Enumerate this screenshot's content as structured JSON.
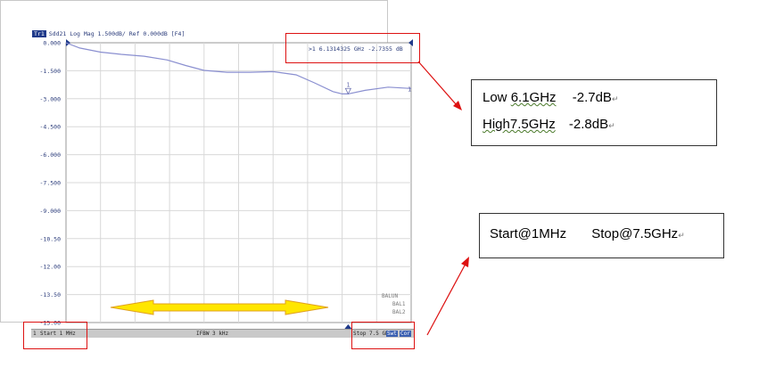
{
  "trace_header": {
    "badge": "Tr1",
    "text": "Sdd21 Log Mag 1.500dB/ Ref 0.000dB [F4]"
  },
  "marker_readout": ">1  6.1314325 GHz -2.7355 dB",
  "chart_data": {
    "type": "line",
    "title": "",
    "xlabel": "",
    "ylabel": "",
    "x_unit": "GHz",
    "xlim": [
      0.001,
      7.5
    ],
    "ylim": [
      -15.0,
      0.0
    ],
    "y_ticks": [
      "0.000",
      "-1.500",
      "-3.000",
      "-4.500",
      "-6.000",
      "-7.500",
      "-9.000",
      "-10.50",
      "-12.00",
      "-13.50",
      "-15.00"
    ],
    "grid": true,
    "series": [
      {
        "color": "#8a8fd0",
        "x": [
          0.001,
          0.3,
          0.75,
          1.2,
          1.7,
          2.2,
          2.6,
          3.0,
          3.5,
          4.0,
          4.5,
          5.0,
          5.4,
          5.8,
          6.0,
          6.13,
          6.5,
          7.0,
          7.5
        ],
        "y": [
          0.0,
          -0.28,
          -0.5,
          -0.62,
          -0.72,
          -0.92,
          -1.22,
          -1.48,
          -1.58,
          -1.58,
          -1.55,
          -1.72,
          -2.15,
          -2.62,
          -2.74,
          -2.74,
          -2.55,
          -2.38,
          -2.45
        ]
      }
    ],
    "marker": {
      "label": "1",
      "x": 6.1314325,
      "y": -2.7355
    }
  },
  "balun_legend": [
    "BALUN",
    "BAL1",
    "BAL2"
  ],
  "status_bar": {
    "channel": "1",
    "start": "Start 1 MHz",
    "ifbw": "IFBW 3 kHz",
    "stop": "Stop 7.5 GHz",
    "btn1": "Swt",
    "btn2": "Cor"
  },
  "annotations": {
    "low_label": "Low",
    "low_freq": "6.1GHz",
    "low_db": "-2.7dB",
    "high_label": "High7.5GHz",
    "high_db": "-2.8dB",
    "start_text": "Start@1MHz",
    "stop_text": "Stop@7.5GHz",
    "para_mark": "↵"
  },
  "colors": {
    "accent_red": "#dd1111",
    "trace": "#8a8fd0",
    "arrow_fill": "#ffe600",
    "arrow_stroke": "#e0a020"
  }
}
